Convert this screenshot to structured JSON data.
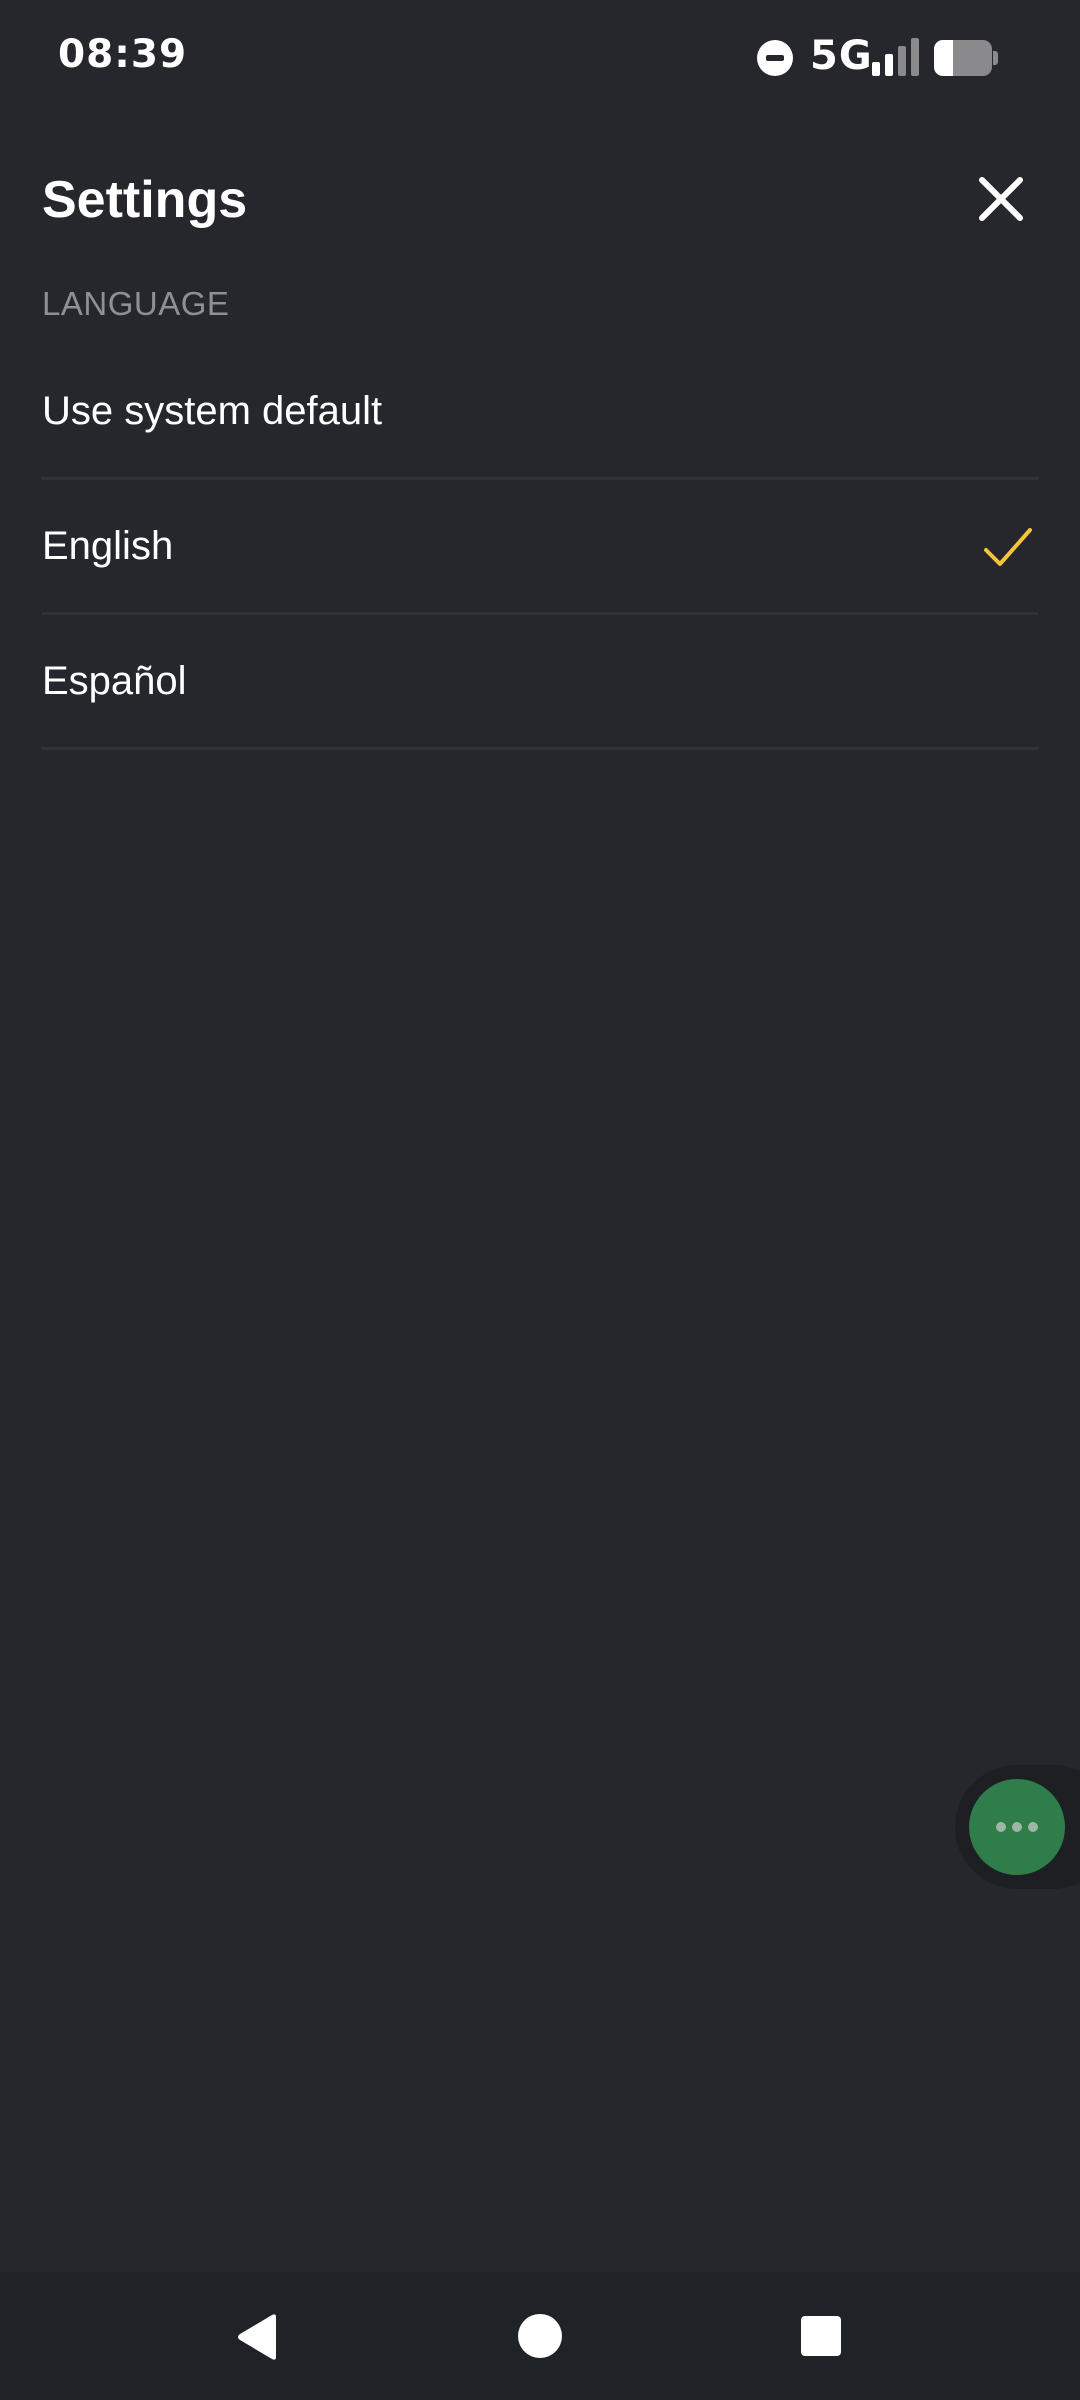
{
  "status_bar": {
    "time": "08:39",
    "network": "5G",
    "battery_level": 0.33,
    "signal_bars": [
      {
        "color": "#ffffff"
      },
      {
        "color": "#ffffff"
      },
      {
        "color": "#8a8a8d"
      },
      {
        "color": "#8a8a8d"
      }
    ],
    "icons": [
      "do-not-disturb-icon",
      "signal-icon",
      "battery-icon"
    ]
  },
  "header": {
    "title": "Settings",
    "close_icon": "close-icon"
  },
  "language_section": {
    "header": "LANGUAGE",
    "options": [
      {
        "label": "Use system default",
        "selected": false
      },
      {
        "label": "English",
        "selected": true
      },
      {
        "label": "Español",
        "selected": false
      }
    ],
    "check_color": "#f5c43b"
  },
  "floating_bubble": {
    "icon": "more-icon",
    "color": "#2e7d4a"
  },
  "nav_bar": {
    "icons": [
      "back-icon",
      "home-icon",
      "recents-icon"
    ]
  },
  "colors": {
    "background": "#25272c",
    "divider": "#30333a",
    "section_text": "#8d9096"
  }
}
